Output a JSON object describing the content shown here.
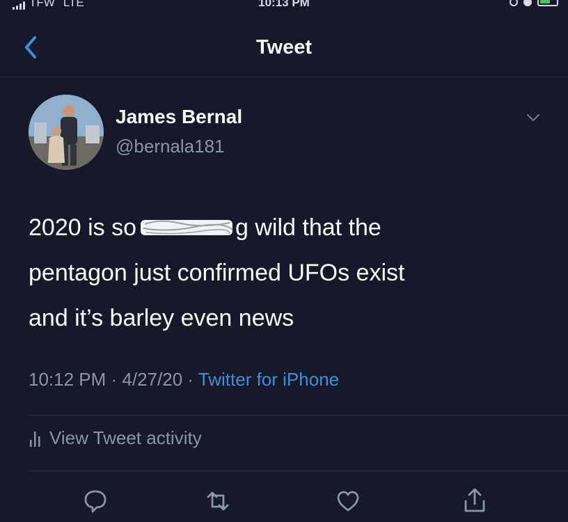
{
  "status_bar": {
    "carrier": "TFW",
    "network": "LTE",
    "time": "10:13 PM"
  },
  "nav": {
    "title": "Tweet",
    "back_icon": "chevron-left-icon"
  },
  "tweet": {
    "author": {
      "display_name": "James Bernal",
      "handle": "@bernala181"
    },
    "text": {
      "line1_before": "2020 is so",
      "line1_after": "g wild that the",
      "line2": "pentagon just confirmed UFOs exist",
      "line3": "and it’s barley even news"
    },
    "meta": {
      "time": "10:12 PM",
      "separator": " · ",
      "date": "4/27/20",
      "source": "Twitter for iPhone"
    }
  },
  "activity": {
    "label": "View Tweet activity",
    "icon": "bar-chart-icon"
  },
  "actions": {
    "reply_icon": "speech-bubble-icon",
    "retweet_icon": "retweet-icon",
    "like_icon": "heart-icon",
    "share_icon": "share-icon"
  },
  "colors": {
    "background": "#15192a",
    "link": "#3d8fd8",
    "secondary_text": "#8b95a5"
  }
}
